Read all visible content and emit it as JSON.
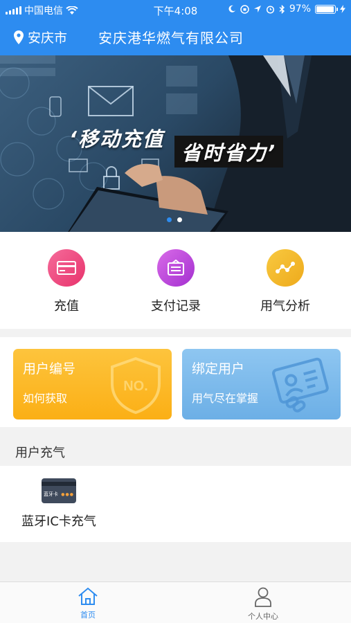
{
  "status_bar": {
    "carrier": "中国电信",
    "time": "下午4:08",
    "battery_percent": "97%",
    "battery_level": 0.97
  },
  "nav": {
    "location": "安庆市",
    "title": "安庆港华燃气有限公司"
  },
  "banner": {
    "slogan_part1": "‘移动充值",
    "slogan_part2": "省时省力’",
    "slide_count": 2,
    "active_slide": 1
  },
  "quick_menu": [
    {
      "label": "充值",
      "icon": "card-icon",
      "color": "#ee3f7b"
    },
    {
      "label": "支付记录",
      "icon": "receipt-icon",
      "color": "#b03fd8"
    },
    {
      "label": "用气分析",
      "icon": "chart-icon",
      "color": "#f3b62a"
    }
  ],
  "cards": {
    "user_number": {
      "title": "用户编号",
      "subtitle": "如何获取",
      "color": "#fbb720",
      "badge": "NO."
    },
    "bind_user": {
      "title": "绑定用户",
      "subtitle": "用气尽在掌握",
      "color": "#7ab8ea"
    }
  },
  "section": {
    "title": "用户充气",
    "items": [
      {
        "label": "蓝牙IC卡充气",
        "card_text": "蓝牙卡"
      }
    ]
  },
  "tabbar": {
    "home": "首页",
    "profile": "个人中心",
    "active_color": "#2d8cf0",
    "inactive_color": "#666666"
  }
}
